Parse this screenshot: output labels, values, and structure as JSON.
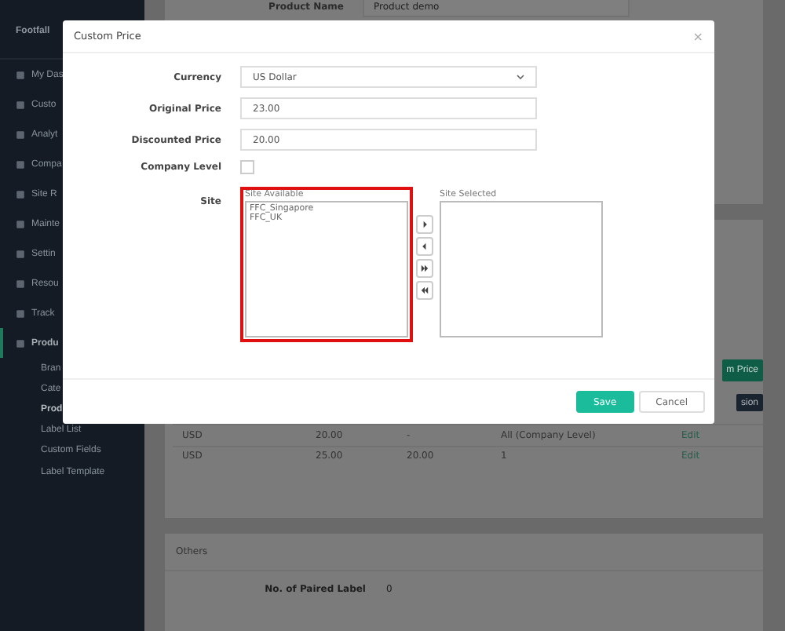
{
  "sidebar": {
    "brand": "Footfall",
    "items": [
      {
        "label": "My Das",
        "selected": false
      },
      {
        "label": "Custo",
        "selected": false
      },
      {
        "label": "Analyt",
        "selected": false
      },
      {
        "label": "Compa",
        "selected": false
      },
      {
        "label": "Site R",
        "selected": false
      },
      {
        "label": "Mainte",
        "selected": false
      },
      {
        "label": "Settin",
        "selected": false
      },
      {
        "label": "Resou",
        "selected": false
      },
      {
        "label": "Track",
        "selected": false
      },
      {
        "label": "Produ",
        "selected": true,
        "children": [
          {
            "label": "Bran",
            "selected": false
          },
          {
            "label": "Cate",
            "selected": false
          },
          {
            "label": "Prod",
            "selected": true
          },
          {
            "label": "Label List",
            "selected": false
          },
          {
            "label": "Custom Fields",
            "selected": false
          },
          {
            "label": "Label Template",
            "selected": false
          }
        ]
      }
    ]
  },
  "product": {
    "label": "Product Name",
    "value": "Product demo"
  },
  "price_panel": {
    "buttons": [
      "m Price",
      "sion"
    ],
    "rows": [
      [
        "USD",
        "20.00",
        "-",
        "All (Company Level)",
        "Edit"
      ],
      [
        "USD",
        "25.00",
        "20.00",
        "1",
        "Edit"
      ]
    ]
  },
  "others": {
    "title": "Others",
    "fields": [
      {
        "label": "No. of Paired Label",
        "value": "0"
      }
    ]
  },
  "modal": {
    "title": "Custom Price",
    "close": "×",
    "currency": {
      "label": "Currency",
      "value": "US Dollar"
    },
    "original_price": {
      "label": "Original Price",
      "value": "23.00"
    },
    "discounted_price": {
      "label": "Discounted Price",
      "value": "20.00"
    },
    "company_level": {
      "label": "Company Level",
      "checked": false
    },
    "site": {
      "label": "Site",
      "available_label": "Site Available",
      "available": [
        "FFC_Singapore",
        "FFC_UK"
      ],
      "selected_label": "Site Selected",
      "highlighted": true
    },
    "buttons": [
      {
        "label": "Save",
        "kind": "primary"
      },
      {
        "label": "Cancel",
        "kind": "default"
      }
    ]
  }
}
